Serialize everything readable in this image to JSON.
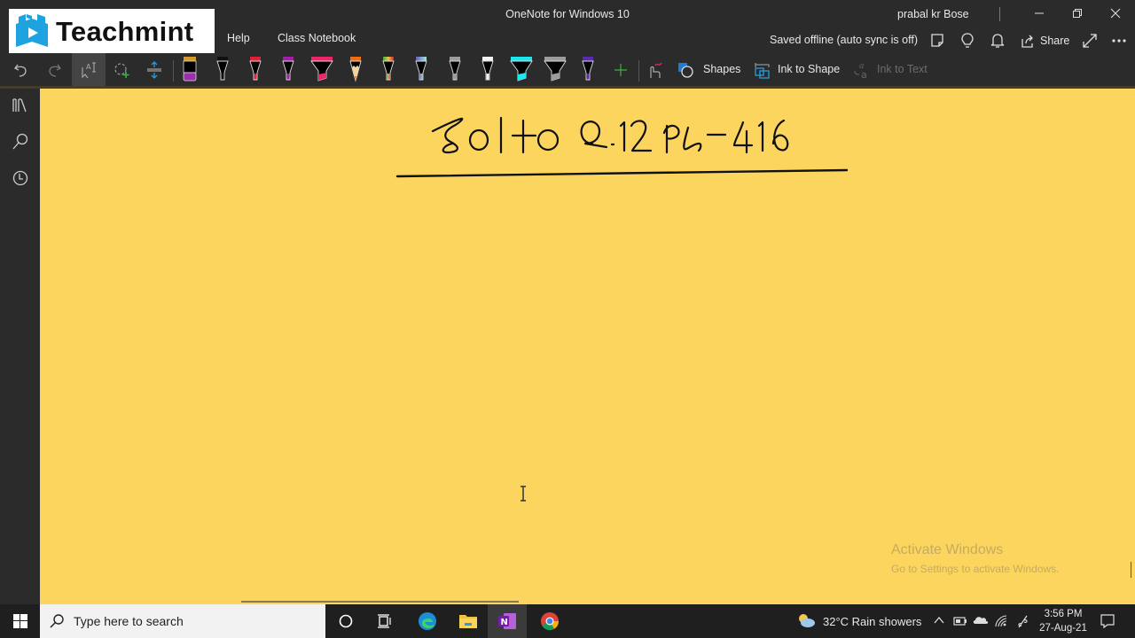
{
  "window": {
    "app_title": "OneNote for Windows 10",
    "user_name": "prabal kr Bose",
    "controls": [
      "minimize",
      "restore",
      "close"
    ]
  },
  "logo": {
    "text": "Teachmint",
    "brand_color": "#1fa3e0"
  },
  "menu": {
    "items": [
      "Help",
      "Class Notebook"
    ]
  },
  "header": {
    "status": "Saved offline (auto sync is off)",
    "share_label": "Share",
    "icons": [
      "sticky-notes-icon",
      "lightbulb-icon",
      "bell-icon",
      "share-icon",
      "expand-icon",
      "more-icon"
    ]
  },
  "toolbar": {
    "tools": [
      "undo",
      "redo",
      "lasso-select",
      "add-shape",
      "insert-space"
    ],
    "pens": [
      {
        "kind": "eraser",
        "color": "#9b2fae"
      },
      {
        "kind": "pen",
        "color": "#111111"
      },
      {
        "kind": "pen",
        "color": "#e0203c"
      },
      {
        "kind": "pen",
        "color": "#a21fa5"
      },
      {
        "kind": "highlighter",
        "color": "#f0246a"
      },
      {
        "kind": "pencil",
        "color": "#f26c0c"
      },
      {
        "kind": "pen",
        "color": "rainbow"
      },
      {
        "kind": "pen",
        "color": "galaxy"
      },
      {
        "kind": "pen",
        "color": "#9c9c9c"
      },
      {
        "kind": "pen",
        "color": "#f4f4f4"
      },
      {
        "kind": "highlighter",
        "color": "#1be7f0"
      },
      {
        "kind": "highlighter",
        "color": "#9c9c9c"
      },
      {
        "kind": "pen",
        "color": "#5a2bb0"
      }
    ],
    "add_pen_label": "+",
    "shapes_label": "Shapes",
    "ink_to_shape_label": "Ink to Shape",
    "ink_to_text_label": "Ink to Text"
  },
  "sidebar": {
    "items": [
      "notebooks-icon",
      "search-icon",
      "recent-icon"
    ]
  },
  "page": {
    "handwritten_title": "Sol to Q.12 Pg-416",
    "background_color": "#fcd55e"
  },
  "watermark": {
    "title": "Activate Windows",
    "subtitle": "Go to Settings to activate Windows."
  },
  "taskbar": {
    "search_placeholder": "Type here to search",
    "apps": [
      "cortana",
      "task-view",
      "edge",
      "file-explorer",
      "onenote",
      "chrome"
    ],
    "weather": "32°C  Rain showers",
    "time": "3:56 PM",
    "date": "27-Aug-21"
  }
}
